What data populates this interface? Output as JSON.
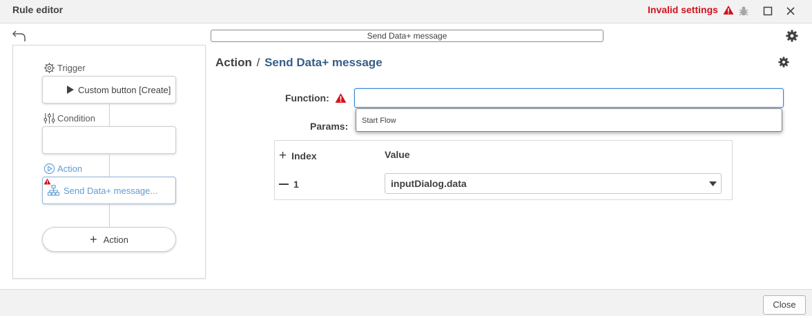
{
  "window": {
    "title": "Rule editor",
    "status_text": "Invalid settings",
    "colors": {
      "error": "#d4111d",
      "accent": "#3b8ad9",
      "link": "#385d87"
    }
  },
  "toolbar": {
    "rule_name": "Send Data+ message"
  },
  "flow": {
    "trigger_label": "Trigger",
    "trigger_box": "Custom button [Create]",
    "condition_label": "Condition",
    "condition_box": "",
    "action_label": "Action",
    "action_box": "Send Data+ message...",
    "add_action_label": "Action"
  },
  "main": {
    "breadcrumb_root": "Action",
    "breadcrumb_sep": "/",
    "breadcrumb_current": "Send Data+ message",
    "function_label": "Function:",
    "function_value": "",
    "dropdown_options": [
      "Start Flow"
    ],
    "params_label": "Params:",
    "params_table": {
      "headers": {
        "index": "Index",
        "value": "Value"
      },
      "rows": [
        {
          "index": "1",
          "value": "inputDialog.data"
        }
      ]
    }
  },
  "footer": {
    "close_label": "Close"
  }
}
